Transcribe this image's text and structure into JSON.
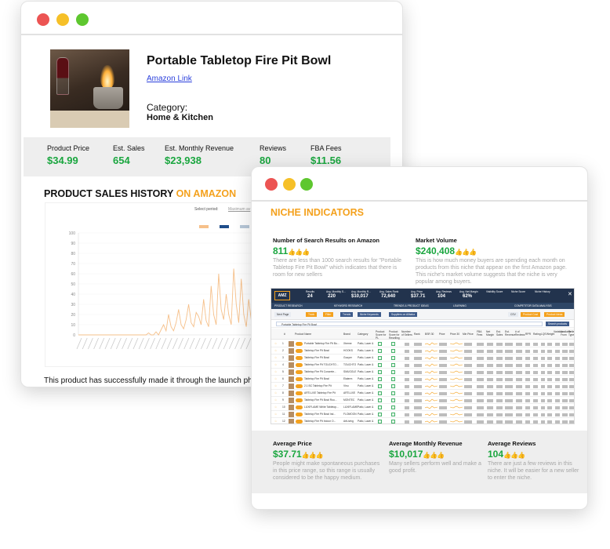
{
  "product": {
    "title": "Portable Tabletop Fire Pit Bowl",
    "link_text": "Amazon Link",
    "category_label": "Category:",
    "category_value": "Home & Kitchen",
    "stats": [
      {
        "label": "Product Price",
        "value": "$34.99"
      },
      {
        "label": "Est. Sales",
        "value": "654"
      },
      {
        "label": "Est. Monthly Revenue",
        "value": "$23,938"
      },
      {
        "label": "Reviews",
        "value": "80"
      },
      {
        "label": "FBA Fees",
        "value": "$11.56"
      }
    ],
    "history_title": "PRODUCT SALES HISTORY",
    "history_title_accent": "ON AMAZON",
    "chart_select_period": "Select period:",
    "chart_max_period": "Maximum av",
    "bottom_text": "This product has successfully made it through the launch pha"
  },
  "chart_data": {
    "type": "line",
    "title": "",
    "xlabel": "",
    "ylabel": "",
    "ylim": [
      0,
      100
    ],
    "y_ticks": [
      0,
      10,
      20,
      30,
      40,
      50,
      60,
      70,
      80,
      90,
      100
    ],
    "series": [
      {
        "color": "#f6c08a",
        "values": [
          0,
          0,
          0,
          0,
          0,
          0,
          0,
          0,
          0,
          0,
          0,
          0,
          0,
          0,
          0,
          0,
          0,
          0,
          0,
          0,
          0,
          0,
          0,
          0,
          0,
          0,
          0,
          0,
          2,
          0,
          0,
          3,
          0,
          5,
          10,
          4,
          20,
          8,
          4,
          12,
          25,
          10,
          6,
          15,
          30,
          12,
          8,
          22,
          18,
          10,
          35,
          14,
          8,
          48,
          20,
          10,
          60,
          25,
          15,
          40,
          20,
          10,
          65,
          30,
          12,
          55,
          20,
          8,
          35,
          15,
          5,
          25,
          10,
          4,
          15,
          6,
          2,
          8
        ]
      }
    ],
    "legend": [
      "",
      "",
      ""
    ],
    "legend_colors": [
      "#f6c08a",
      "#1f4d8a",
      "#b8c8d8"
    ]
  },
  "niche": {
    "title": "NICHE INDICATORS",
    "search_label": "Number of Search Results on Amazon",
    "search_value": "811",
    "search_desc": "There are less than 1000 search results for \"Portable Tabletop Fire Pit Bowl\" which indicates that there is room for new sellers",
    "market_label": "Market Volume",
    "market_value": "$240,408",
    "market_desc": "This is how much money buyers are spending each month on products from this niche that appear on the first Amazon page. This niche's market volume suggests that the niche is very popular among buyers.",
    "thumbs": "👍👍👍",
    "avg_price_label": "Average Price",
    "avg_price_value": "$37.71",
    "avg_price_desc": "People might make spontaneous purchases in this price range, so this range is usually considered to be the happy medium.",
    "avg_rev_label": "Average Monthly Revenue",
    "avg_rev_value": "$10,017",
    "avg_rev_desc": "Many sellers perform well and make a good profit.",
    "avg_reviews_label": "Average Reviews",
    "avg_reviews_value": "104",
    "avg_reviews_desc": "There are just a few reviews in this niche. It will be easier for a new seller to enter the niche."
  },
  "embed": {
    "logo": "AMZ",
    "metrics": [
      {
        "label": "Results",
        "value": "24"
      },
      {
        "label": "Avg. Monthly S...",
        "value": "220"
      },
      {
        "label": "Avg. Monthly R...",
        "value": "$10,017"
      },
      {
        "label": "Avg. Sales Rank",
        "value": "72,640"
      },
      {
        "label": "Avg. Price",
        "value": "$37.71"
      },
      {
        "label": "Avg. Reviews",
        "value": "104"
      },
      {
        "label": "Avg. Net Margin",
        "value": "62%"
      }
    ],
    "scores": [
      "Visibility Score",
      "Niche Score",
      "Niche History"
    ],
    "menu": [
      "PRODUCT RESEARCH",
      "KEYWORD RESEARCH",
      "TRENDS & PRODUCT IDEAS",
      "LEARNING",
      "COMPETITOR DATA ANALYSIS"
    ],
    "toolbar": [
      "Next Page",
      "Track",
      "Filter",
      "Trends",
      "Niche Keywords",
      "Suppliers on Alibaba",
      "CSV",
      "Product Cost",
      "Product Ideas"
    ],
    "search_value": "Portable Tabletop Fire Pit Bowl",
    "search_button": "Search products",
    "columns": [
      "#",
      "Product Name",
      "Brand",
      "Category",
      "Product Score for PL",
      "Product Score for Reselling",
      "Number of Sellers",
      "Rank",
      "BSR 30",
      "Price",
      "Price 30",
      "Min Price",
      "FBA Fees",
      "Net Margin",
      "Est. Sales",
      "Est. Revenue",
      "# of Reviews",
      "RPR",
      "Rating",
      "LQS",
      "Weight",
      "Variation",
      "Available From",
      "Seller Type"
    ],
    "rows": [
      {
        "name": "Portable Tabletop Fire Pit Bo...",
        "brand": "Xtreme",
        "category": "Patio, Lawn &"
      },
      {
        "name": "Tabletop Fire Pit Bowl",
        "brand": "HOOKS",
        "category": "Patio, Lawn &"
      },
      {
        "name": "Tabletop Fire Pit Bowl",
        "brand": "Gooyer",
        "category": "Patio, Lawn &"
      },
      {
        "name": "Tabletop Fire Pit TOUCHTO...",
        "brand": "TOUCHTO",
        "category": "Patio, Lawn &"
      },
      {
        "name": "Tabletop Fire Pit Concrete...",
        "brand": "SMUGGLE",
        "category": "Patio, Lawn &"
      },
      {
        "name": "Tabletop Fire Pit Bowl",
        "brand": "Elaterm",
        "category": "Patio, Lawn &"
      },
      {
        "name": "2.1 BC Tabletop Fire Pit",
        "brand": "Vinu",
        "category": "Patio, Lawn &"
      },
      {
        "name": "ARTLUXE Tabletop Fire Pit",
        "brand": "ARTLUXE",
        "category": "Patio, Lawn &"
      },
      {
        "name": "Tabletop Fire Pit Bowl Rou...",
        "brand": "MONTEC",
        "category": "Patio, Lawn &"
      },
      {
        "name": "LUXIFLAME White Tabletop...",
        "brand": "LUXIFLAME",
        "category": "Patio, Lawn &"
      },
      {
        "name": "Tabletop Fire Pit Bowl Ind...",
        "brand": "FLOMOON",
        "category": "Patio, Lawn &"
      },
      {
        "name": "Tabletop Fire Pit Indoor O...",
        "brand": "ArtLiving",
        "category": "Patio, Lawn &"
      }
    ]
  },
  "colors": {
    "accent": "#f4a11d",
    "value_green": "#1aa63f",
    "link_blue": "#2a3fdc"
  }
}
